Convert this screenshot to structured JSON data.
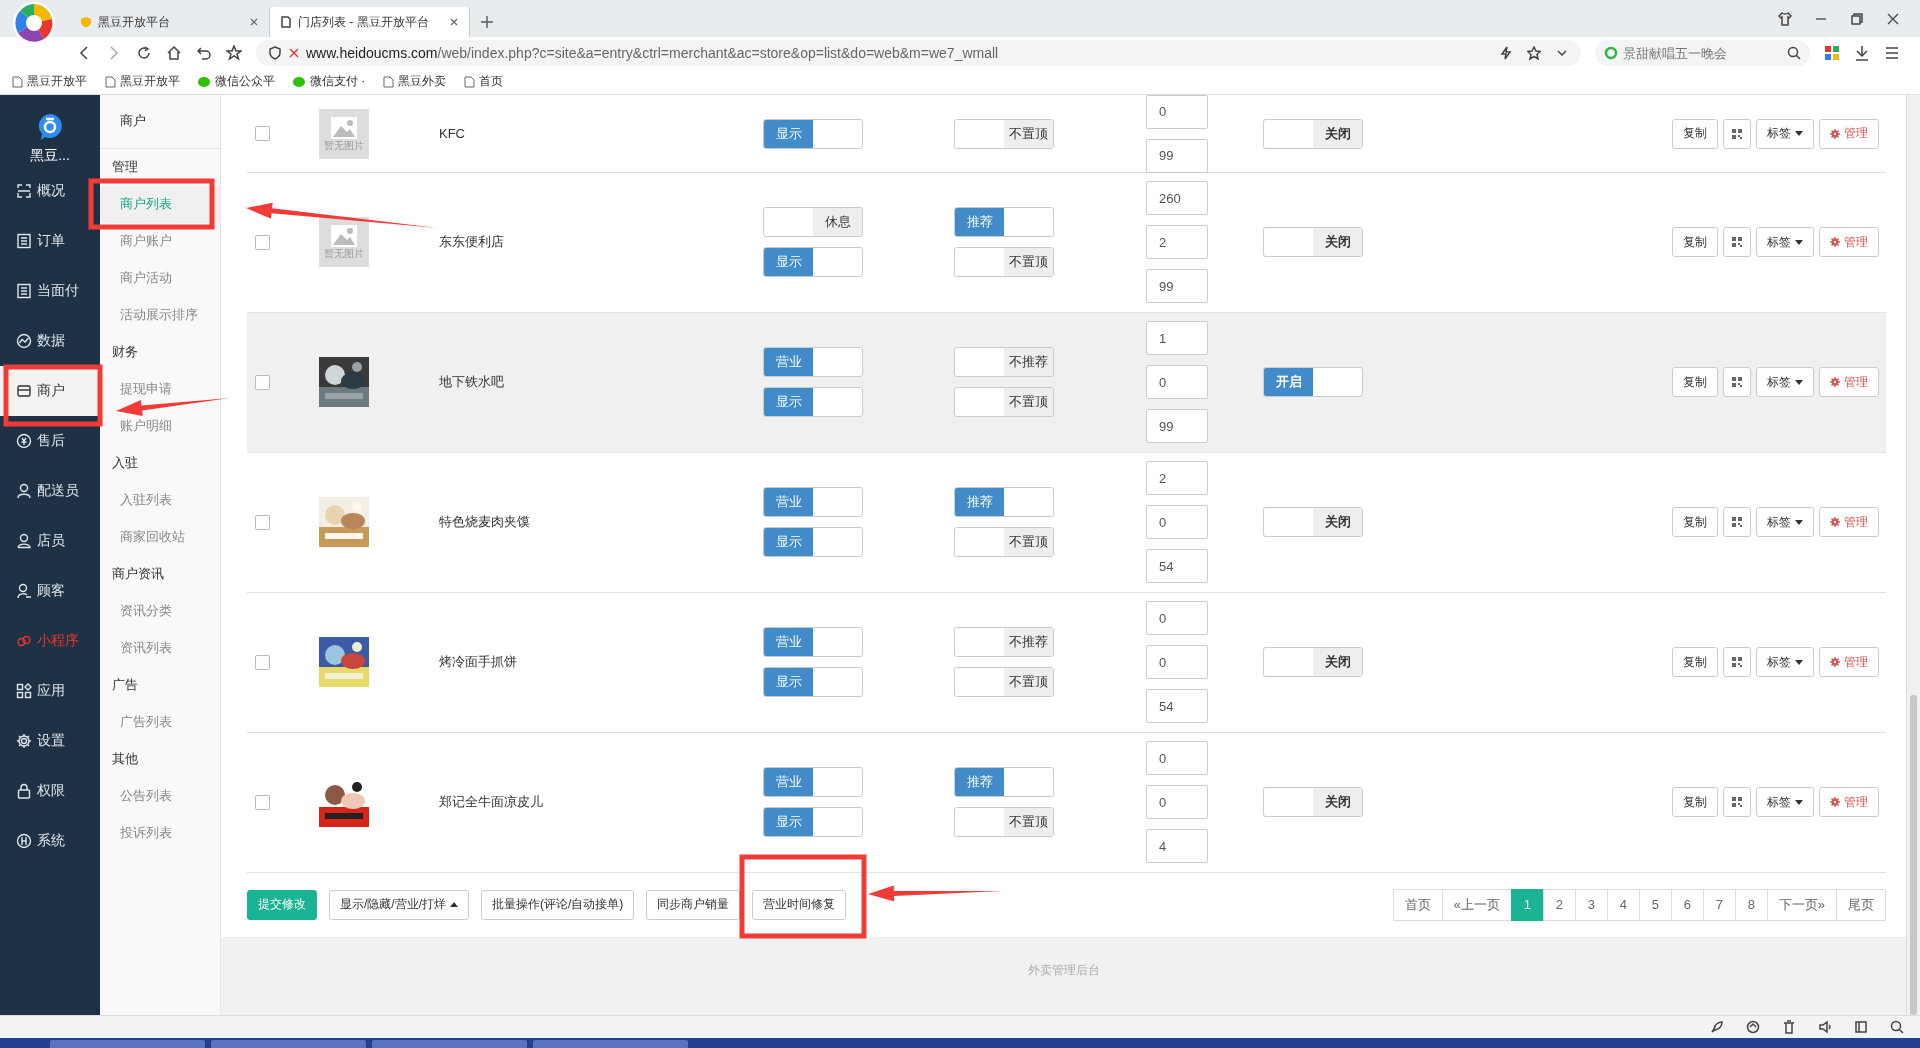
{
  "browser": {
    "tabs": [
      {
        "title": "黑豆开放平台",
        "selected": false
      },
      {
        "title": "门店列表 - 黑豆开放平台",
        "selected": true
      }
    ],
    "url": {
      "host": "www.heidoucms.com",
      "path": "/web/index.php?c=site&a=entry&ctrl=merchant&ac=store&op=list&do=web&m=we7_wmall"
    },
    "search": {
      "placeholder": "景甜献唱五一晚会"
    },
    "bookmarks": [
      {
        "label": "黑豆开放平",
        "kind": "page"
      },
      {
        "label": "黑豆开放平",
        "kind": "page"
      },
      {
        "label": "微信公众平",
        "kind": "wechat"
      },
      {
        "label": "微信支付 ·",
        "kind": "wechat"
      },
      {
        "label": "黑豆外卖",
        "kind": "page"
      },
      {
        "label": "首页",
        "kind": "page"
      }
    ]
  },
  "sidebar": {
    "brand": "黑豆...",
    "items": [
      {
        "label": "概况",
        "selected": false,
        "accent": false
      },
      {
        "label": "订单",
        "selected": false,
        "accent": false
      },
      {
        "label": "当面付",
        "selected": false,
        "accent": false
      },
      {
        "label": "数据",
        "selected": false,
        "accent": false
      },
      {
        "label": "商户",
        "selected": true,
        "accent": false
      },
      {
        "label": "售后",
        "selected": false,
        "accent": false
      },
      {
        "label": "配送员",
        "selected": false,
        "accent": false
      },
      {
        "label": "店员",
        "selected": false,
        "accent": false
      },
      {
        "label": "顾客",
        "selected": false,
        "accent": false
      },
      {
        "label": "小程序",
        "selected": false,
        "accent": true
      },
      {
        "label": "应用",
        "selected": false,
        "accent": false
      },
      {
        "label": "设置",
        "selected": false,
        "accent": false
      },
      {
        "label": "权限",
        "selected": false,
        "accent": false
      },
      {
        "label": "系统",
        "selected": false,
        "accent": false
      }
    ]
  },
  "submenu": {
    "title": "商户",
    "groups": [
      {
        "title": "管理",
        "items": [
          {
            "label": "商户列表",
            "selected": true
          },
          {
            "label": "商户账户",
            "selected": false
          },
          {
            "label": "商户活动",
            "selected": false
          },
          {
            "label": "活动展示排序",
            "selected": false
          }
        ]
      },
      {
        "title": "财务",
        "items": [
          {
            "label": "提现申请",
            "selected": false
          },
          {
            "label": "账户明细",
            "selected": false
          }
        ]
      },
      {
        "title": "入驻",
        "items": [
          {
            "label": "入驻列表",
            "selected": false
          },
          {
            "label": "商家回收站",
            "selected": false
          }
        ]
      },
      {
        "title": "商户资讯",
        "items": [
          {
            "label": "资讯分类",
            "selected": false
          },
          {
            "label": "资讯列表",
            "selected": false
          }
        ]
      },
      {
        "title": "广告",
        "items": [
          {
            "label": "广告列表",
            "selected": false
          }
        ]
      },
      {
        "title": "其他",
        "items": [
          {
            "label": "公告列表",
            "selected": false
          },
          {
            "label": "投诉列表",
            "selected": false
          }
        ]
      }
    ]
  },
  "rows": [
    {
      "partial": true,
      "highlighted": false,
      "checked": false,
      "image": {
        "kind": "placeholder",
        "caption": "暂无图片"
      },
      "name": "KFC",
      "toggles_a": [
        {
          "label": "显示",
          "on": true
        }
      ],
      "toggles_b": [
        {
          "label": "不置顶",
          "on": false
        }
      ],
      "numbers": [
        "0",
        "99"
      ],
      "switch": {
        "label": "关闭",
        "on": false
      },
      "actions": [
        "复制",
        "标签",
        "管理"
      ]
    },
    {
      "partial": false,
      "highlighted": false,
      "checked": false,
      "image": {
        "kind": "placeholder",
        "caption": "暂无图片"
      },
      "name": "东东便利店",
      "toggles_a": [
        {
          "label": "休息",
          "on": false
        },
        {
          "label": "显示",
          "on": true
        }
      ],
      "toggles_b": [
        {
          "label": "推荐",
          "on": true
        },
        {
          "label": "不置顶",
          "on": false
        }
      ],
      "numbers": [
        "260",
        "2",
        "99"
      ],
      "switch": {
        "label": "关闭",
        "on": false
      },
      "actions": [
        "复制",
        "标签",
        "管理"
      ]
    },
    {
      "partial": false,
      "highlighted": true,
      "checked": false,
      "image": {
        "kind": "picture"
      },
      "name": "地下铁水吧",
      "toggles_a": [
        {
          "label": "营业",
          "on": true
        },
        {
          "label": "显示",
          "on": true
        }
      ],
      "toggles_b": [
        {
          "label": "不推荐",
          "on": false
        },
        {
          "label": "不置顶",
          "on": false
        }
      ],
      "numbers": [
        "1",
        "0",
        "99"
      ],
      "switch": {
        "label": "开启",
        "on": true
      },
      "actions": [
        "复制",
        "标签",
        "管理"
      ]
    },
    {
      "partial": false,
      "highlighted": false,
      "checked": false,
      "image": {
        "kind": "picture"
      },
      "name": "特色烧麦肉夹馍",
      "toggles_a": [
        {
          "label": "营业",
          "on": true
        },
        {
          "label": "显示",
          "on": true
        }
      ],
      "toggles_b": [
        {
          "label": "推荐",
          "on": true
        },
        {
          "label": "不置顶",
          "on": false
        }
      ],
      "numbers": [
        "2",
        "0",
        "54"
      ],
      "switch": {
        "label": "关闭",
        "on": false
      },
      "actions": [
        "复制",
        "标签",
        "管理"
      ]
    },
    {
      "partial": false,
      "highlighted": false,
      "checked": false,
      "image": {
        "kind": "picture"
      },
      "name": "烤冷面手抓饼",
      "toggles_a": [
        {
          "label": "营业",
          "on": true
        },
        {
          "label": "显示",
          "on": true
        }
      ],
      "toggles_b": [
        {
          "label": "不推荐",
          "on": false
        },
        {
          "label": "不置顶",
          "on": false
        }
      ],
      "numbers": [
        "0",
        "0",
        "54"
      ],
      "switch": {
        "label": "关闭",
        "on": false
      },
      "actions": [
        "复制",
        "标签",
        "管理"
      ]
    },
    {
      "partial": false,
      "highlighted": false,
      "checked": false,
      "image": {
        "kind": "picture"
      },
      "name": "郑记全牛面凉皮儿",
      "toggles_a": [
        {
          "label": "营业",
          "on": true
        },
        {
          "label": "显示",
          "on": true
        }
      ],
      "toggles_b": [
        {
          "label": "推荐",
          "on": true
        },
        {
          "label": "不置顶",
          "on": false
        }
      ],
      "numbers": [
        "0",
        "0",
        "4"
      ],
      "switch": {
        "label": "关闭",
        "on": false
      },
      "actions": [
        "复制",
        "标签",
        "管理"
      ]
    }
  ],
  "footer_buttons": [
    {
      "label": "提交修改",
      "kind": "primary"
    },
    {
      "label": "显示/隐藏/营业/打烊",
      "kind": "dropup"
    },
    {
      "label": "批量操作(评论/自动接单)",
      "kind": "plain"
    },
    {
      "label": "同步商户销量",
      "kind": "plain"
    },
    {
      "label": "营业时间修复",
      "kind": "plain"
    }
  ],
  "pagination": [
    {
      "label": "首页",
      "selected": false
    },
    {
      "label": "«上一页",
      "selected": false
    },
    {
      "label": "1",
      "selected": true
    },
    {
      "label": "2",
      "selected": false
    },
    {
      "label": "3",
      "selected": false
    },
    {
      "label": "4",
      "selected": false
    },
    {
      "label": "5",
      "selected": false
    },
    {
      "label": "6",
      "selected": false
    },
    {
      "label": "7",
      "selected": false
    },
    {
      "label": "8",
      "selected": false
    },
    {
      "label": "下一页»",
      "selected": false
    },
    {
      "label": "尾页",
      "selected": false
    }
  ],
  "copyright": "外卖管理后台"
}
